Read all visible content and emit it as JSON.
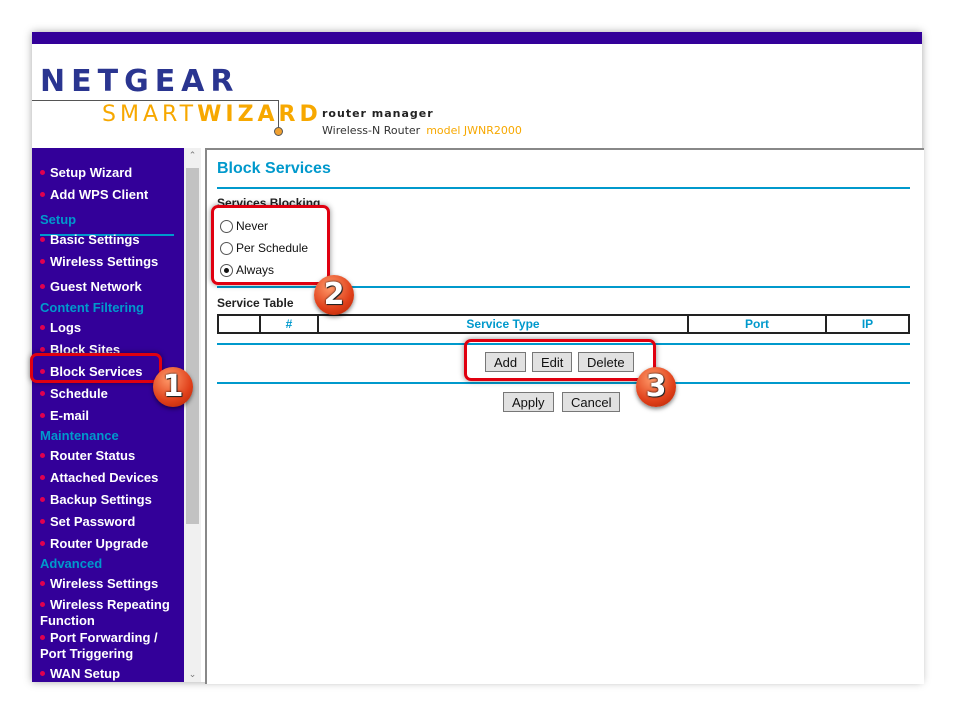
{
  "header": {
    "logo_top": "NETGEAR",
    "logo_smart": "SMART",
    "logo_wizard": "WIZARD",
    "router_manager": "router manager",
    "product": "Wireless-N Router",
    "model": "model JWNR2000"
  },
  "sidebar": {
    "items": [
      {
        "type": "item",
        "label": "Setup Wizard"
      },
      {
        "type": "item",
        "label": "Add WPS Client"
      },
      {
        "type": "heading",
        "label": "Setup"
      },
      {
        "type": "item",
        "label": "Basic Settings"
      },
      {
        "type": "item",
        "label": "Wireless Settings"
      },
      {
        "type": "item",
        "label": "Guest Network"
      },
      {
        "type": "heading",
        "label": "Content Filtering"
      },
      {
        "type": "item",
        "label": "Logs"
      },
      {
        "type": "item",
        "label": "Block Sites"
      },
      {
        "type": "item",
        "label": "Block Services",
        "active": true
      },
      {
        "type": "item",
        "label": "Schedule"
      },
      {
        "type": "item",
        "label": "E-mail"
      },
      {
        "type": "heading",
        "label": "Maintenance"
      },
      {
        "type": "item",
        "label": "Router Status"
      },
      {
        "type": "item",
        "label": "Attached Devices"
      },
      {
        "type": "item",
        "label": "Backup Settings"
      },
      {
        "type": "item",
        "label": "Set Password"
      },
      {
        "type": "item",
        "label": "Router Upgrade"
      },
      {
        "type": "heading",
        "label": "Advanced"
      },
      {
        "type": "item",
        "label": "Wireless Settings"
      },
      {
        "type": "item",
        "label": "Wireless Repeating Function"
      },
      {
        "type": "item",
        "label": "Port Forwarding / Port Triggering"
      },
      {
        "type": "item",
        "label": "WAN Setup"
      }
    ]
  },
  "main": {
    "title": "Block Services",
    "blocking_label": "Services Blocking",
    "options": [
      {
        "label": "Never",
        "checked": false
      },
      {
        "label": "Per Schedule",
        "checked": false
      },
      {
        "label": "Always",
        "checked": true
      }
    ],
    "table_label": "Service Table",
    "columns": [
      "",
      "#",
      "Service Type",
      "Port",
      "IP"
    ],
    "add": "Add",
    "edit": "Edit",
    "delete": "Delete",
    "apply": "Apply",
    "cancel": "Cancel"
  },
  "annotations": [
    "1",
    "2",
    "3"
  ],
  "colors": {
    "brand_purple": "#330099",
    "accent_blue": "#0099cc",
    "highlight_red": "#e00010"
  }
}
